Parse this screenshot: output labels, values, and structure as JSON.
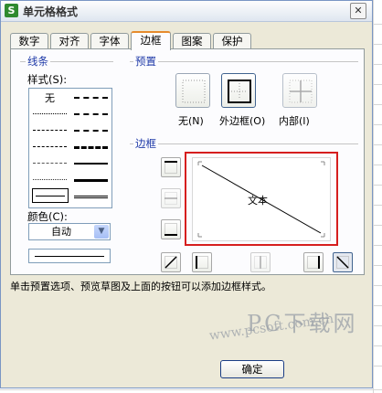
{
  "window": {
    "title": "单元格格式",
    "app_icon_letter": "S",
    "close_glyph": "✕"
  },
  "tabs": [
    {
      "label": "数字",
      "active": false
    },
    {
      "label": "对齐",
      "active": false
    },
    {
      "label": "字体",
      "active": false
    },
    {
      "label": "边框",
      "active": true
    },
    {
      "label": "图案",
      "active": false
    },
    {
      "label": "保护",
      "active": false
    }
  ],
  "line_group": {
    "title": "线条",
    "style_label": "样式(S):",
    "none_label": "无",
    "color_label": "颜色(C):",
    "color_value": "自动"
  },
  "presets": {
    "title": "预置",
    "none_label": "无(N)",
    "outline_label": "外边框(O)",
    "inside_label": "内部(I)"
  },
  "border": {
    "title": "边框",
    "preview_text": "文本"
  },
  "instruction": "单击预置选项、预览草图及上面的按钮可以添加边框样式。",
  "buttons": {
    "ok": "确定"
  },
  "watermark": {
    "text": "PC下载网",
    "url": "www.pcsoft.com.cn"
  },
  "colors": {
    "highlight_border": "#d61e1e",
    "accent_tab": "#e68b2c",
    "label_blue": "#1f3aa8"
  }
}
